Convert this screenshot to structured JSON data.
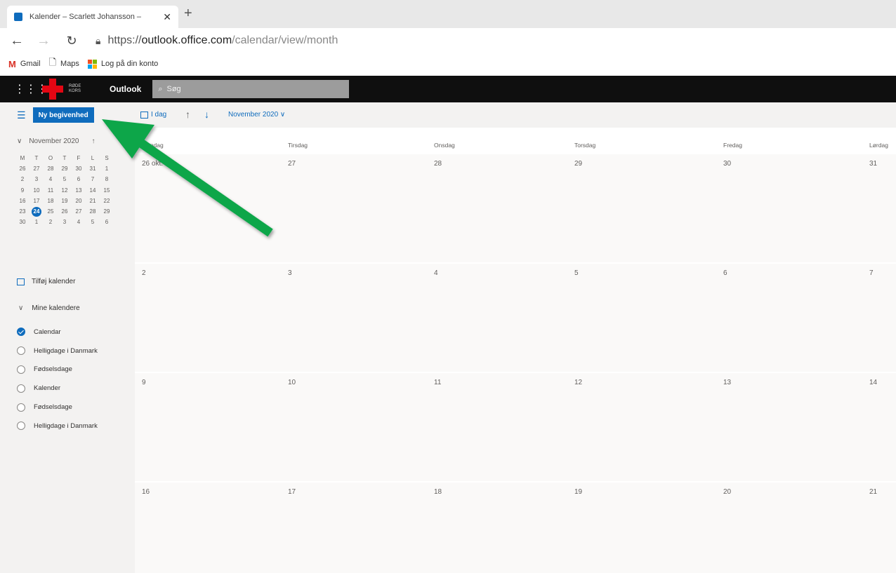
{
  "browser": {
    "tab_title": "Kalender – Scarlett Johansson –",
    "tab_close": "✕",
    "new_tab": "+",
    "url_scheme": "https://",
    "url_host": "outlook.office.com",
    "url_path": "/calendar/view/month"
  },
  "bookmarks": [
    {
      "label": "Gmail"
    },
    {
      "label": "Maps"
    },
    {
      "label": "Log på din konto"
    }
  ],
  "outlook": {
    "app_title": "Outlook",
    "org_line1": "RØDE",
    "org_line2": "KORS",
    "search_placeholder": "Søg"
  },
  "commandbar": {
    "new_event_label": "Ny begivenhed",
    "today_label": "I dag",
    "month_label": "November 2020 ∨"
  },
  "mini_calendar": {
    "title": "November 2020",
    "weekday_headers": [
      "M",
      "T",
      "O",
      "T",
      "F",
      "L",
      "S"
    ],
    "weeks": [
      [
        "26",
        "27",
        "28",
        "29",
        "30",
        "31",
        "1"
      ],
      [
        "2",
        "3",
        "4",
        "5",
        "6",
        "7",
        "8"
      ],
      [
        "9",
        "10",
        "11",
        "12",
        "13",
        "14",
        "15"
      ],
      [
        "16",
        "17",
        "18",
        "19",
        "20",
        "21",
        "22"
      ],
      [
        "23",
        "24",
        "25",
        "26",
        "27",
        "28",
        "29"
      ],
      [
        "30",
        "1",
        "2",
        "3",
        "4",
        "5",
        "6"
      ]
    ],
    "today": "24"
  },
  "sidebar": {
    "add_calendar": "Tilføj kalender",
    "my_calendars": "Mine kalendere",
    "calendars": [
      {
        "label": "Calendar",
        "checked": true
      },
      {
        "label": "Helligdage i Danmark",
        "checked": false
      },
      {
        "label": "Fødselsdage",
        "checked": false
      },
      {
        "label": "Kalender",
        "checked": false
      },
      {
        "label": "Fødselsdage",
        "checked": false
      },
      {
        "label": "Helligdage i Danmark",
        "checked": false
      }
    ]
  },
  "month_grid": {
    "weekdays": [
      "Mandag",
      "Tirsdag",
      "Onsdag",
      "Torsdag",
      "Fredag",
      "Lørdag"
    ],
    "weeks": [
      [
        "26 okt.",
        "27",
        "28",
        "29",
        "30",
        "31"
      ],
      [
        "2",
        "3",
        "4",
        "5",
        "6",
        "7"
      ],
      [
        "9",
        "10",
        "11",
        "12",
        "13",
        "14"
      ],
      [
        "16",
        "17",
        "18",
        "19",
        "20",
        "21"
      ]
    ]
  },
  "annotation": {
    "arrow_color": "#0aa64a"
  },
  "colors": {
    "accent": "#0f6cbd",
    "header_bg": "#0f0f0f",
    "red_cross": "#e30613"
  }
}
